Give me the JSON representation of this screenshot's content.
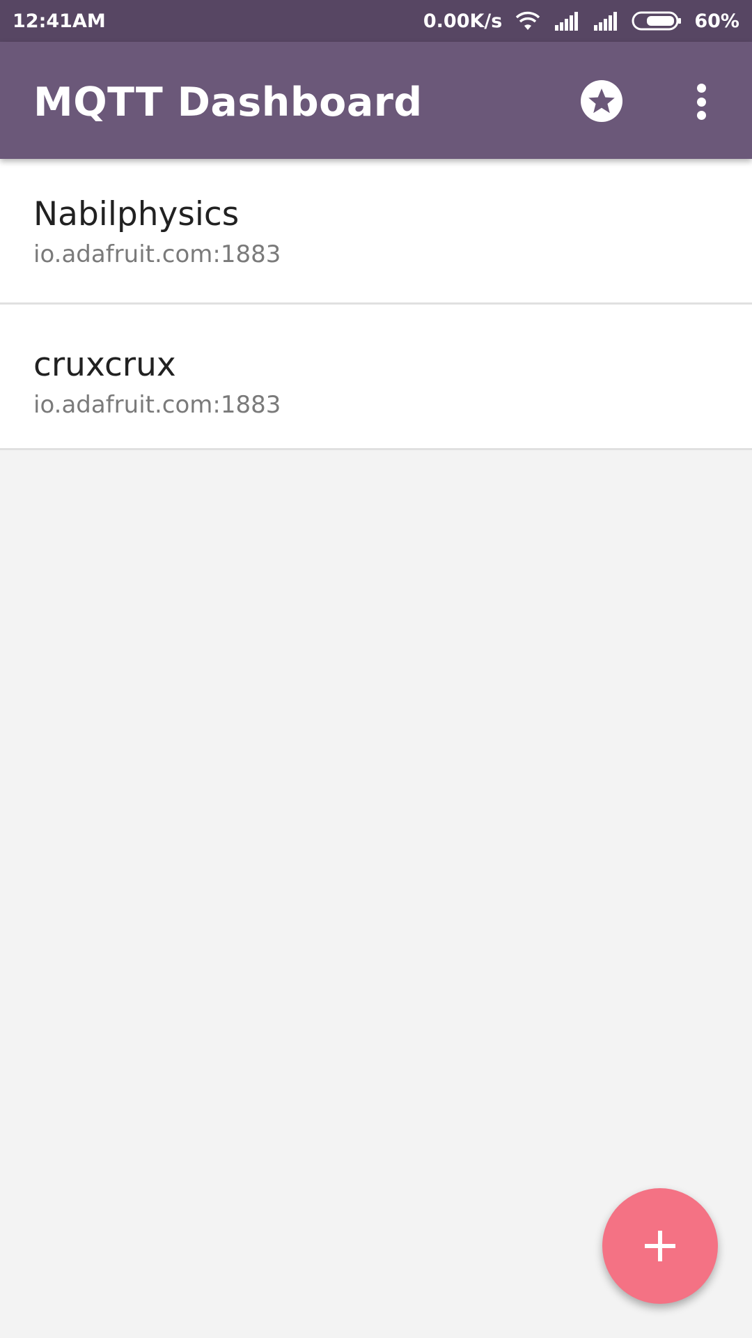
{
  "status_bar": {
    "time": "12:41AM",
    "network_speed": "0.00K/s",
    "battery": "60%",
    "icons": [
      "wifi-icon",
      "signal-icon",
      "signal-icon",
      "battery-icon"
    ]
  },
  "app_bar": {
    "title": "MQTT Dashboard",
    "actions": [
      "star-icon",
      "more-vert-icon"
    ]
  },
  "brokers": [
    {
      "name": "Nabilphysics",
      "address": "io.adafruit.com:1883"
    },
    {
      "name": "cruxcrux",
      "address": "io.adafruit.com:1883"
    }
  ],
  "fab": {
    "icon": "add-icon"
  },
  "colors": {
    "status_bar": "#574663",
    "app_bar": "#6b5879",
    "fab": "#f47284",
    "background": "#f3f3f3"
  }
}
